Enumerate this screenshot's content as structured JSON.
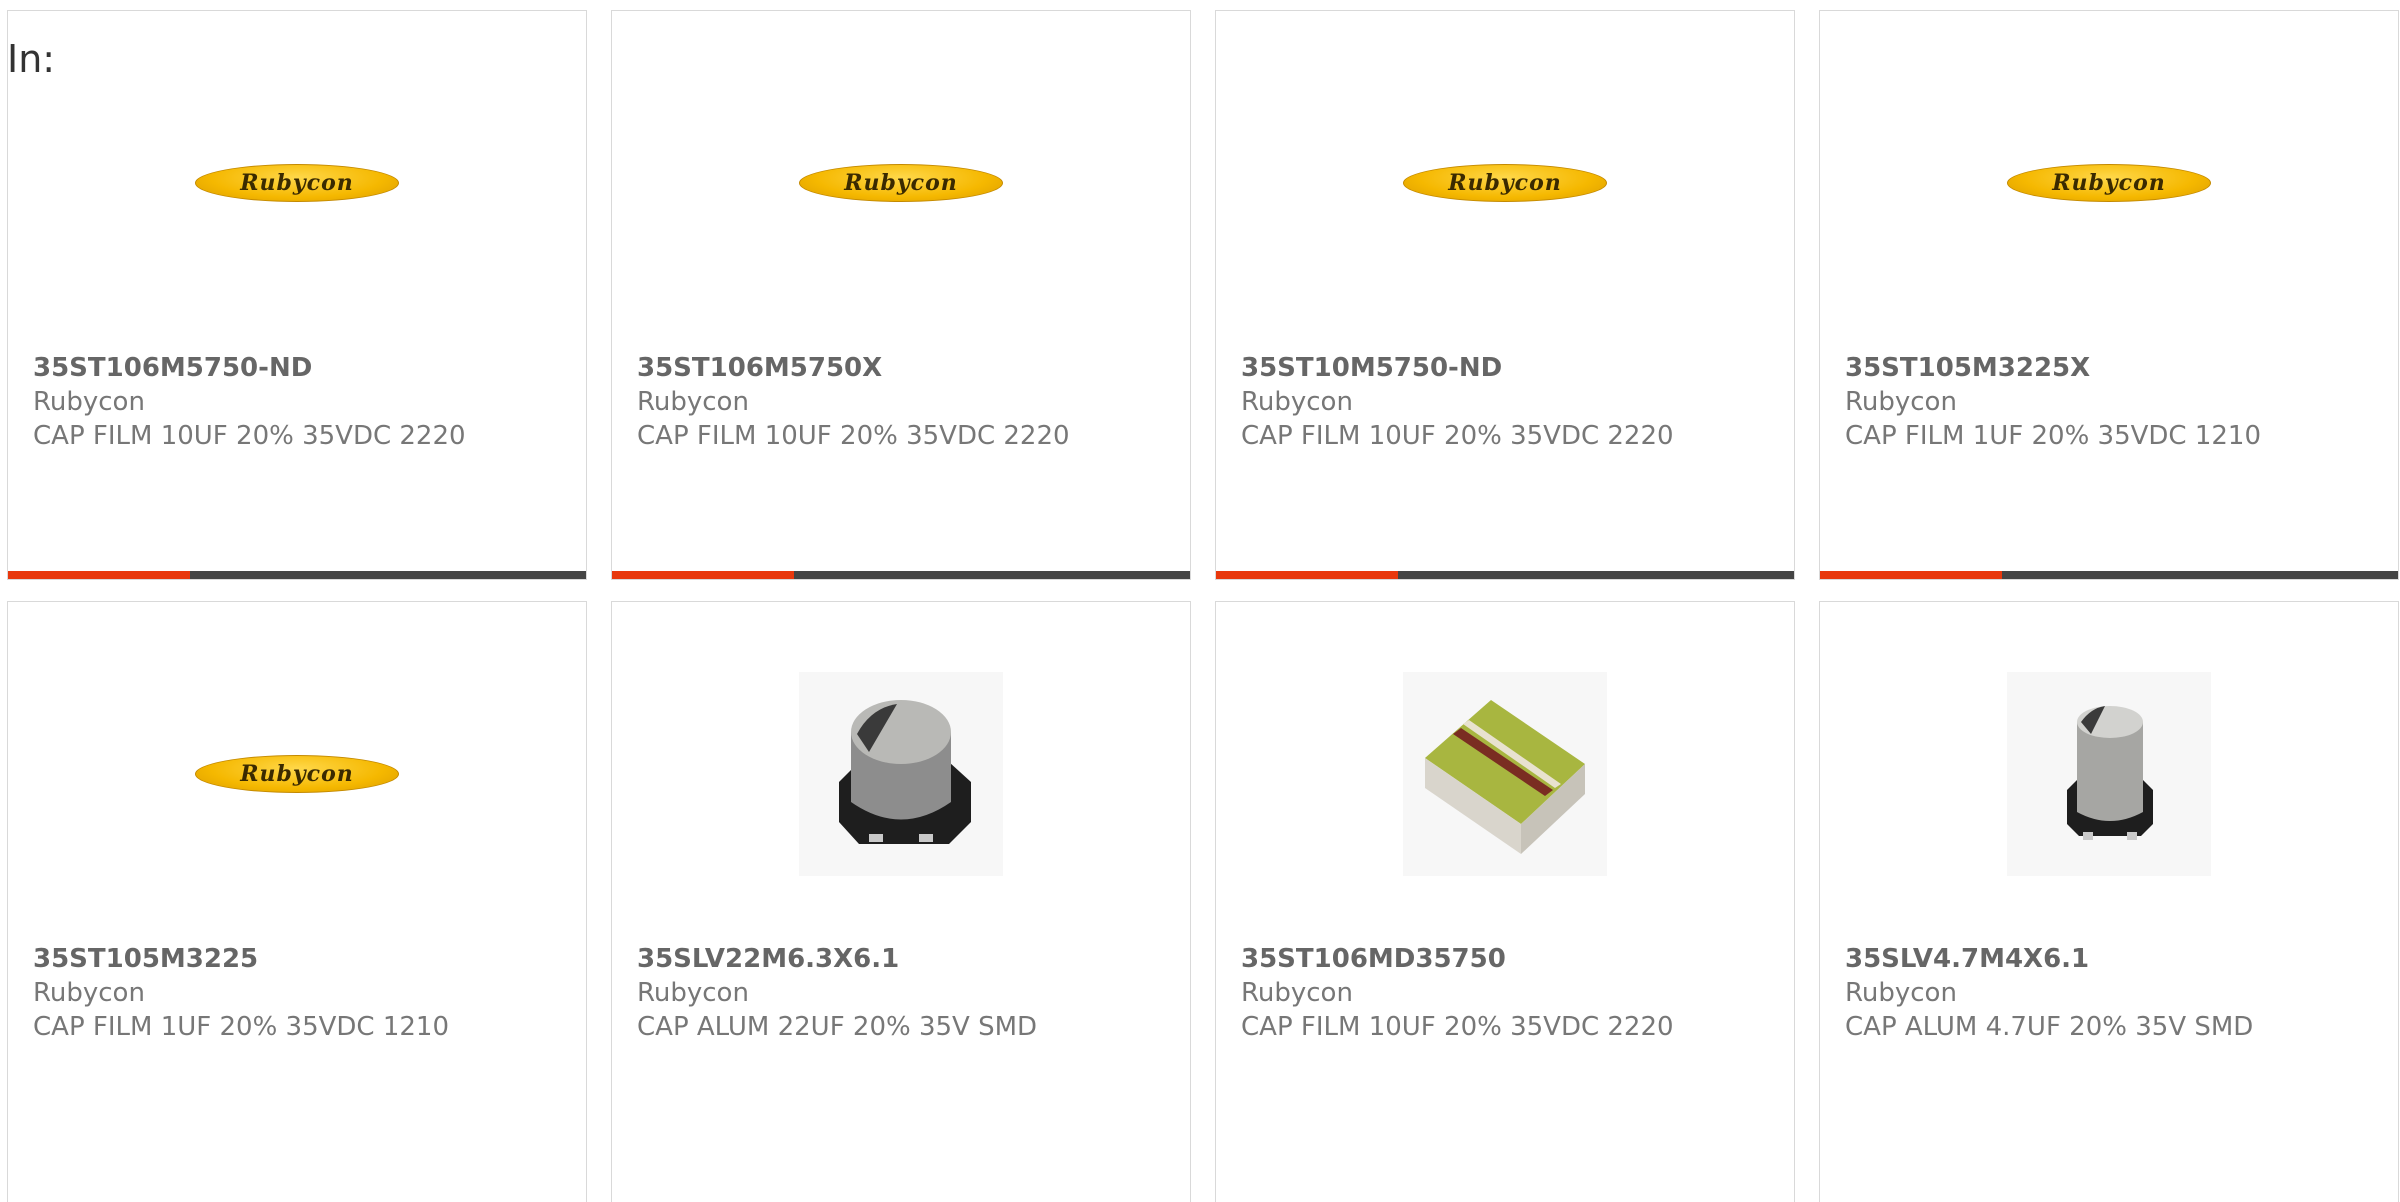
{
  "header": {
    "in_label": "In:"
  },
  "brand_logo_text": "Rubycon",
  "colors": {
    "accent": "#e8380d",
    "bar_dark": "#444444",
    "logo_yellow": "#f5b800"
  },
  "products": [
    {
      "part": "35ST106M5750-ND",
      "manufacturer": "Rubycon",
      "description": "CAP FILM 10UF 20% 35VDC 2220",
      "image": "rubycon-logo"
    },
    {
      "part": "35ST106M5750X",
      "manufacturer": "Rubycon",
      "description": "CAP FILM 10UF 20% 35VDC 2220",
      "image": "rubycon-logo"
    },
    {
      "part": "35ST10M5750-ND",
      "manufacturer": "Rubycon",
      "description": "CAP FILM 10UF 20% 35VDC 2220",
      "image": "rubycon-logo"
    },
    {
      "part": "35ST105M3225X",
      "manufacturer": "Rubycon",
      "description": "CAP FILM 1UF 20% 35VDC 1210",
      "image": "rubycon-logo"
    },
    {
      "part": "35ST105M3225",
      "manufacturer": "Rubycon",
      "description": "CAP FILM 1UF 20% 35VDC 1210",
      "image": "rubycon-logo"
    },
    {
      "part": "35SLV22M6.3X6.1",
      "manufacturer": "Rubycon",
      "description": "CAP ALUM 22UF 20% 35V SMD",
      "image": "electrolytic-capacitor-smd"
    },
    {
      "part": "35ST106MD35750",
      "manufacturer": "Rubycon",
      "description": "CAP FILM 10UF 20% 35VDC 2220",
      "image": "film-capacitor-chip"
    },
    {
      "part": "35SLV4.7M4X6.1",
      "manufacturer": "Rubycon",
      "description": "CAP ALUM 4.7UF 20% 35V SMD",
      "image": "electrolytic-capacitor-smd-small"
    }
  ]
}
